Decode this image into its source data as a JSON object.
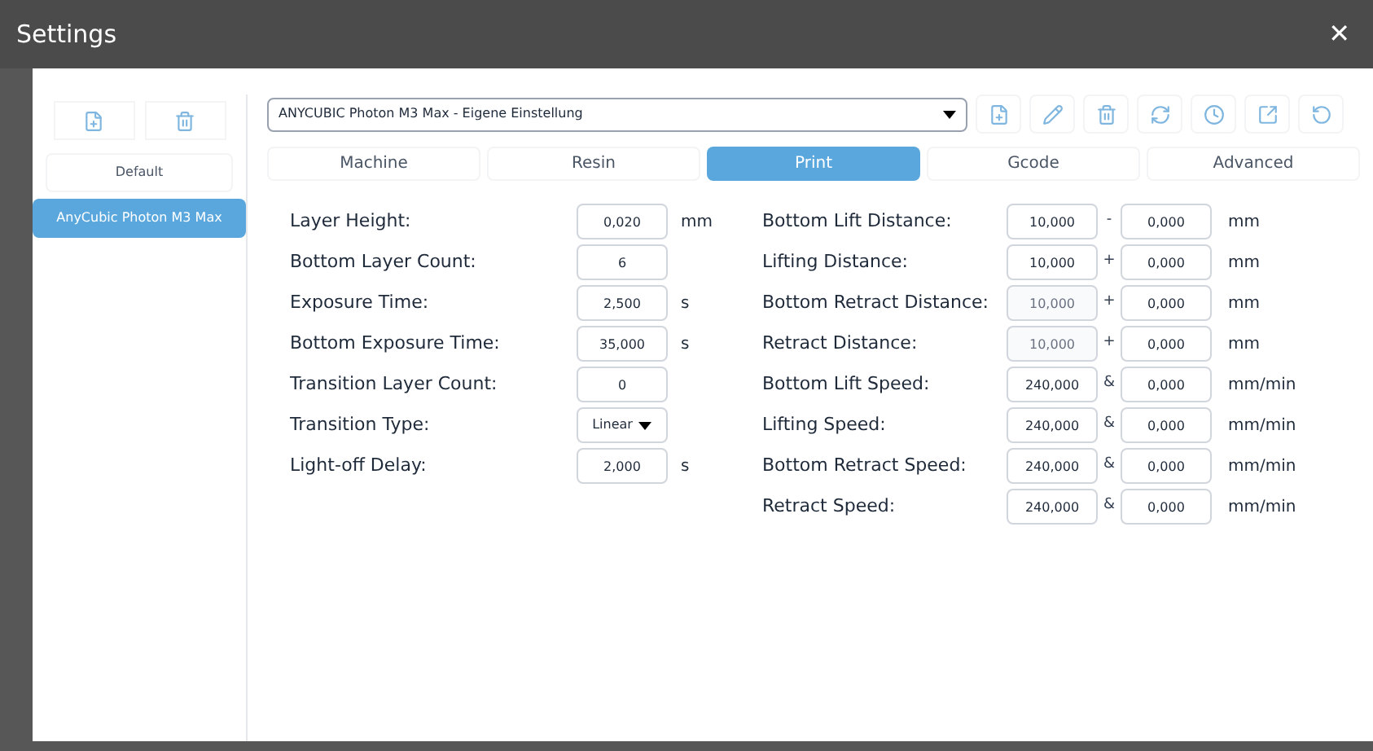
{
  "window": {
    "title": "Settings",
    "close": "✕"
  },
  "sidebar": {
    "presets": [
      {
        "label": "Default",
        "selected": false
      },
      {
        "label": "AnyCubic Photon M3 Max",
        "selected": true
      }
    ]
  },
  "profile": {
    "value": "ANYCUBIC Photon M3 Max - Eigene Einstellung"
  },
  "tabs": [
    {
      "label": "Machine",
      "selected": false
    },
    {
      "label": "Resin",
      "selected": false
    },
    {
      "label": "Print",
      "selected": true
    },
    {
      "label": "Gcode",
      "selected": false
    },
    {
      "label": "Advanced",
      "selected": false
    }
  ],
  "left_params": [
    {
      "kind": "field",
      "label": "Layer Height:",
      "value": "0,020",
      "unit": "mm"
    },
    {
      "kind": "field",
      "label": "Bottom Layer Count:",
      "value": "6"
    },
    {
      "kind": "field",
      "label": "Exposure Time:",
      "value": "2,500",
      "unit": "s"
    },
    {
      "kind": "field",
      "label": "Bottom Exposure Time:",
      "value": "35,000",
      "unit": "s"
    },
    {
      "kind": "field",
      "label": "Transition Layer Count:",
      "value": "0"
    },
    {
      "kind": "select",
      "label": "Transition Type:",
      "value": "Linear"
    },
    {
      "kind": "field",
      "label": "Light-off Delay:",
      "value": "2,000",
      "unit": "s"
    }
  ],
  "right_params": [
    {
      "label": "Bottom Lift Distance:",
      "value": "10,000",
      "disabled": false,
      "separator": "-",
      "value_2": "0,000",
      "unit": "mm"
    },
    {
      "label": "Lifting Distance:",
      "value": "10,000",
      "disabled": false,
      "separator": "+",
      "value_2": "0,000",
      "unit": "mm"
    },
    {
      "label": "Bottom Retract Distance:",
      "value": "10,000",
      "disabled": true,
      "separator": "+",
      "value_2": "0,000",
      "unit": "mm"
    },
    {
      "label": "Retract Distance:",
      "value": "10,000",
      "disabled": true,
      "separator": "+",
      "value_2": "0,000",
      "unit": "mm"
    },
    {
      "label": "Bottom Lift Speed:",
      "value": "240,000",
      "disabled": false,
      "separator": "&",
      "value_2": "0,000",
      "unit": "mm/min"
    },
    {
      "label": "Lifting Speed:",
      "value": "240,000",
      "disabled": false,
      "separator": "&",
      "value_2": "0,000",
      "unit": "mm/min"
    },
    {
      "label": "Bottom Retract Speed:",
      "value": "240,000",
      "disabled": false,
      "separator": "&",
      "value_2": "0,000",
      "unit": "mm/min"
    },
    {
      "label": "Retract Speed:",
      "value": "240,000",
      "disabled": false,
      "separator": "&",
      "value_2": "0,000",
      "unit": "mm/min"
    }
  ]
}
